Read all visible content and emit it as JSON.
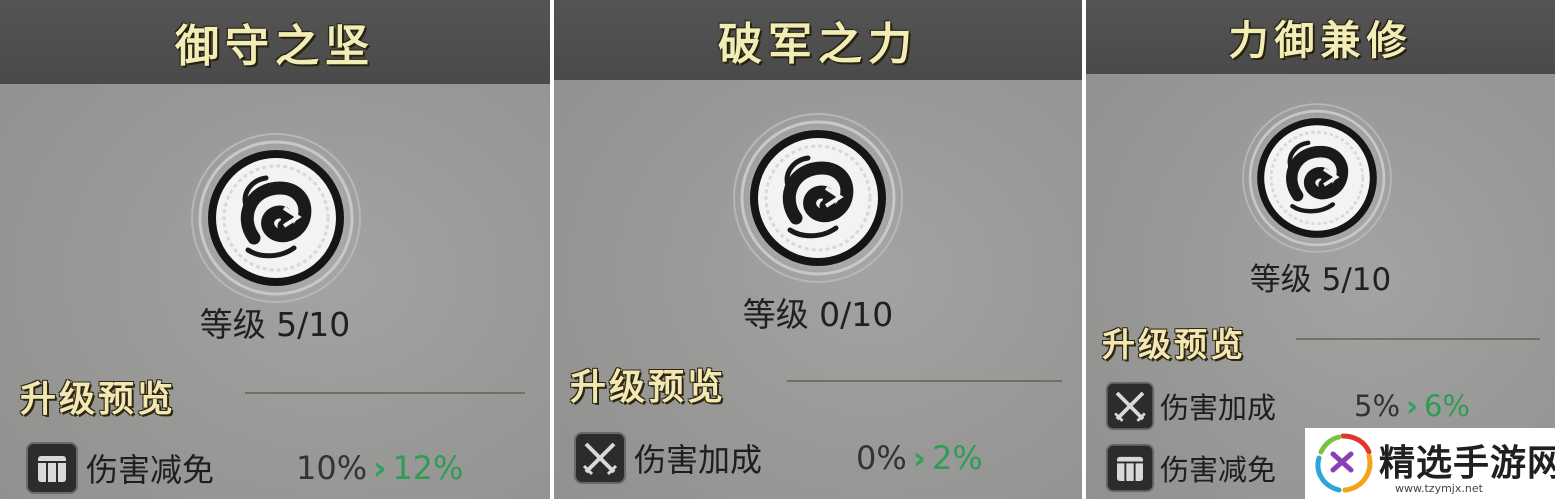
{
  "panels": [
    {
      "title": "御守之坚",
      "emblem_icon": "swirl-emblem-icon",
      "level": "等级 5/10",
      "section_title": "升级预览",
      "stats": [
        {
          "icon": "shield-icon",
          "label": "伤害减免",
          "current": "10%",
          "next": "12%"
        }
      ]
    },
    {
      "title": "破军之力",
      "emblem_icon": "swirl-emblem-icon",
      "level": "等级 0/10",
      "section_title": "升级预览",
      "stats": [
        {
          "icon": "crossed-swords-icon",
          "label": "伤害加成",
          "current": "0%",
          "next": "2%"
        }
      ]
    },
    {
      "title": "力御兼修",
      "emblem_icon": "swirl-emblem-icon",
      "level": "等级 5/10",
      "section_title": "升级预览",
      "stats": [
        {
          "icon": "crossed-swords-icon",
          "label": "伤害加成",
          "current": "5%",
          "next": "6%"
        },
        {
          "icon": "shield-icon",
          "label": "伤害减免",
          "current": "",
          "next": ""
        }
      ]
    }
  ],
  "watermark": {
    "text": "精选手游网",
    "url": "www.tzymjx.net"
  },
  "colors": {
    "title_text": "#f2ecb6",
    "title_bar": "#4e4e4e",
    "panel_bg": "#9a9a98",
    "increase_green": "#2f9c55"
  }
}
